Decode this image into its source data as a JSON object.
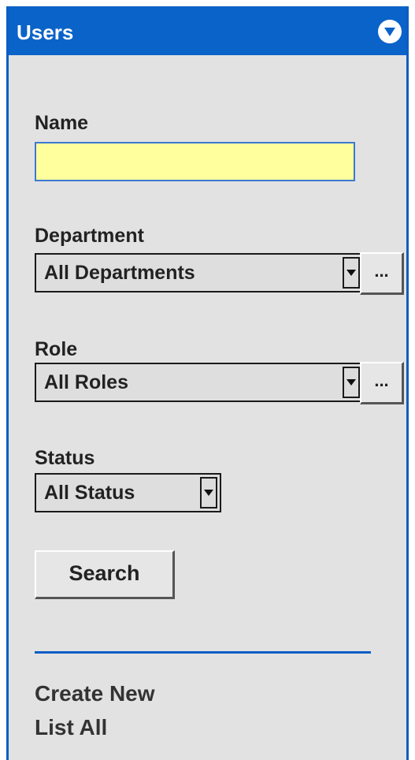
{
  "header": {
    "title": "Users",
    "collapse_icon": "chevron-down-circle-icon"
  },
  "fields": {
    "name": {
      "label": "Name",
      "value": "",
      "placeholder": ""
    },
    "department": {
      "label": "Department",
      "selected": "All Departments",
      "browse_label": "..."
    },
    "role": {
      "label": "Role",
      "selected": "All Roles",
      "browse_label": "..."
    },
    "status": {
      "label": "Status",
      "selected": "All Status"
    }
  },
  "actions": {
    "search_label": "Search"
  },
  "links": {
    "create_new": "Create New",
    "list_all": "List All"
  },
  "colors": {
    "header_bg": "#0a63c8",
    "panel_bg": "#e2e2e2",
    "input_bg": "#ffff9e",
    "accent": "#0a5dc4"
  }
}
